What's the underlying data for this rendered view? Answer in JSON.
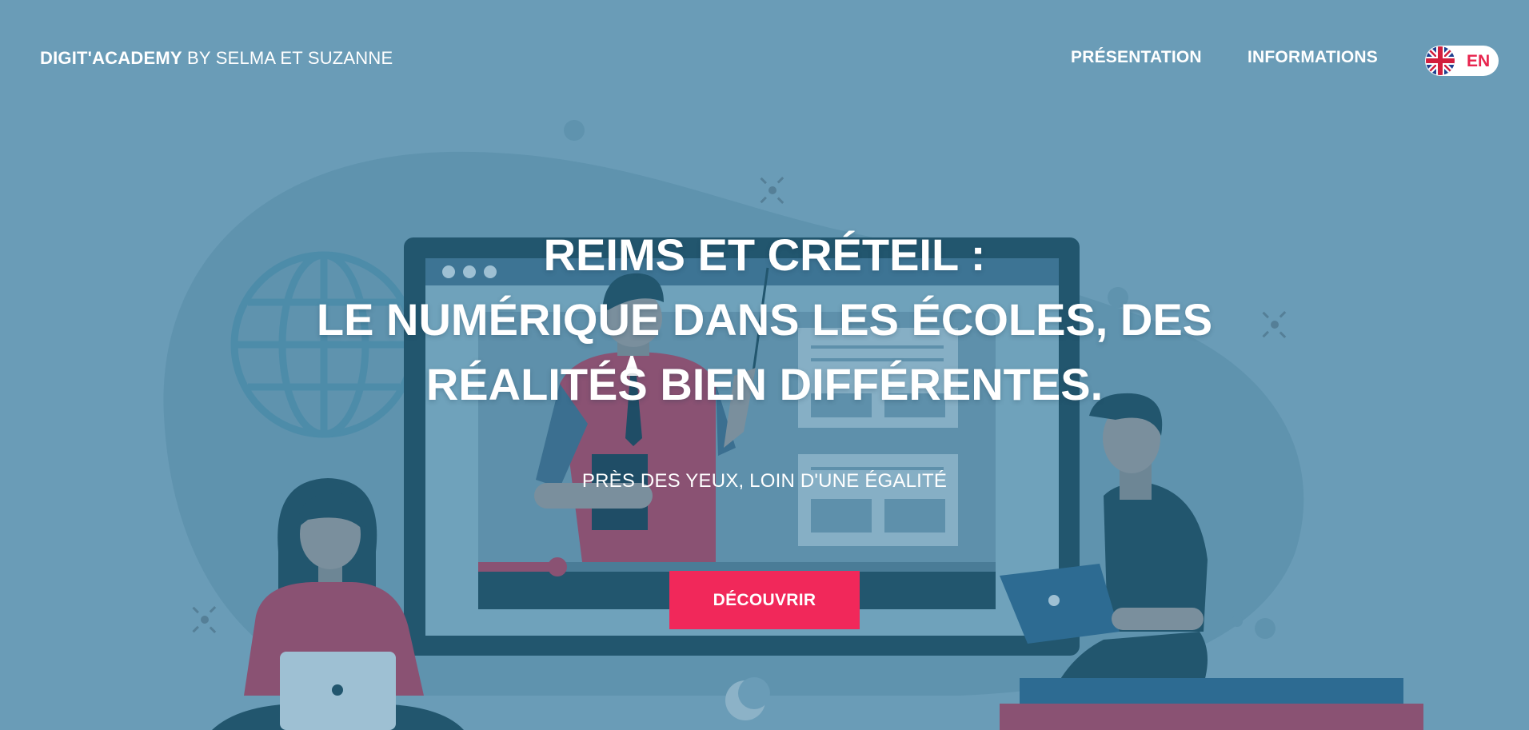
{
  "header": {
    "brand_strong": "DIGIT'ACADEMY",
    "brand_light": " BY SELMA ET SUZANNE",
    "nav": [
      {
        "label": "PRÉSENTATION"
      },
      {
        "label": "INFORMATIONS"
      }
    ],
    "language": {
      "label": "EN",
      "flag_icon": "uk-flag-icon"
    }
  },
  "hero": {
    "title_lines": [
      "REIMS ET CRÉTEIL :",
      "LE NUMÉRIQUE DANS LES ÉCOLES, DES",
      "RÉALITÉS BIEN DIFFÉRENTES."
    ],
    "subtitle": "PRÈS DES YEUX, LOIN D'UNE ÉGALITÉ",
    "cta_label": "DÉCOUVRIR"
  },
  "colors": {
    "background": "#6a9cb7",
    "accent": "#f1285a",
    "lang_text": "#e8254e",
    "text": "#ffffff"
  }
}
